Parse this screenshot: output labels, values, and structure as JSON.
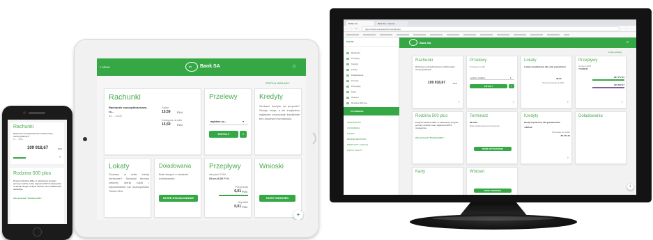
{
  "bank": {
    "name": "Bank SA",
    "logo_text": "BS"
  },
  "phone": {
    "accounts": {
      "title": "Rachunki",
      "account_name": "Rachunek oszczędnościowo-rozliczeniowy",
      "account_sub": "osób prywatnych",
      "account_no": "11 ... 1001",
      "balance": "109 918,67",
      "currency": "PLN"
    },
    "family": {
      "title": "Rodzina 500 plus",
      "description": "Program Rodzina 500+ to państwowy program pomocy rodzinie, który zapewnia 500 zł miesięcznie na każde drugie i kolejne dziecko, bez dodatkowych warunków.",
      "link": "Złóż wniosek \"Rodzina 500+\""
    }
  },
  "tablet": {
    "header": {
      "menu_label": "MENU",
      "logout": "Wyloguj"
    },
    "toolbar_link": "ZERTUJ WIDŁADY",
    "accounts": {
      "title": "Rachunki",
      "account_name": "Rachunek oszczędnościowo-",
      "account_name2": "ro...",
      "account_no": "34 ... 2002",
      "balance_label": "Saldo",
      "balance": "15,59",
      "available_label": "Dostępne środki",
      "available": "15,59",
      "currency": "PLN"
    },
    "transfers": {
      "title": "Przelewy",
      "select": "wybierz sz...",
      "button": "ZWYKŁY"
    },
    "credits": {
      "title": "Kredyty",
      "description": "Szukasz kredytu na przyszłe? Sekcje, twoje, a nie znajdziesz najlepsze propozycje kredytowe bez zbędnych formalności."
    },
    "deposits": {
      "title": "Lokaty",
      "description": "Szukasz w małe lokaty okresowe? Sprawdź terminy zielonej ofertę lokat i odpowiednich lub oszczędności Twoich firm."
    },
    "topups": {
      "title": "Doładowania",
      "description": "Brak danych o zestawie doładowania.",
      "button": "NOWE DOŁADOWANIE"
    },
    "flows": {
      "title": "Przepływy",
      "period": "sierpień 2016",
      "balance_label": "Bilans",
      "balance": "6,00",
      "currency": "PLN",
      "income_label": "Przychody",
      "income": "6,01",
      "expense_label": "Wydatki",
      "expense": "0,01"
    },
    "applications": {
      "title": "Wnioski",
      "button": "NOWY WNIOSEK"
    }
  },
  "monitor": {
    "browser": {
      "tabs": [
        "BANK SA",
        "Bank SA - Internet"
      ],
      "url": "https://bank.example/pl/frontend/pulpit"
    },
    "sidebar": {
      "top_label": "PULPIT",
      "items": [
        "Rachunki",
        "Przelewy",
        "Kredyty",
        "Lokaty",
        "Doładowania",
        "Finanse",
        "Przepływy",
        "Karty",
        "Wnioski",
        "Rodzina 500 plus"
      ],
      "settings": "USTAWIENIA",
      "links": [
        "WIADOMOŚCI",
        "USTAWIENIA",
        "POMOC",
        "BEZPIECZEŃSTWO",
        "PRODUKTY I USŁUGI",
        "KURSY WALUT"
      ]
    },
    "cards_link": "Zmień widżety",
    "tiles": {
      "accounts": {
        "title": "Rachunki",
        "account_name": "Rachunek oszczędnościowo-rozliczeniowy osób prywatnych",
        "balance": "109 918,67",
        "currency": "PLN"
      },
      "transfers": {
        "title": "Przelewy",
        "label": "Dostępne środki",
        "select": "wybierz szablon",
        "button": "ZWYKŁY"
      },
      "deposits": {
        "title": "Lokaty",
        "description": "Lokata standardowa dla osób prywatnych",
        "amount": "36,00",
        "rate": "Oprocentowanie 1,50%"
      },
      "flows": {
        "title": "Przepływy",
        "period": "sierpień 2016",
        "balance": "7 6236,05",
        "income": "927 777,31",
        "expense": "915 542,17"
      },
      "family": {
        "title": "Rodzina 500 plus",
        "description": "Program Rodzina 500+ to państwowy program pomocy rodzinie, który zapewnia 500 zł miesięcznie.",
        "link": "Złóż wniosek \"Rodzina 500+\""
      },
      "terms": {
        "title": "Terminarz",
        "date": "09.2016",
        "description": "Brak zaplanowanych przelewów.",
        "button": "NOWE WYDARZENIE"
      },
      "loans": {
        "title": "Kredyty",
        "description": "Kredyt hipoteczny 311 gotówka PLN",
        "amount": "4 895,32",
        "remaining": "Pozostało do spłaty",
        "remaining_value": "86 271,34"
      },
      "topups": {
        "title": "Doładowania"
      },
      "cards": {
        "title": "Karty"
      },
      "applications": {
        "title": "Wnioski",
        "button": "NOWY WNIOSEK"
      }
    }
  },
  "colors": {
    "brand_green": "#35a845",
    "text_green": "#2e9e3e"
  }
}
